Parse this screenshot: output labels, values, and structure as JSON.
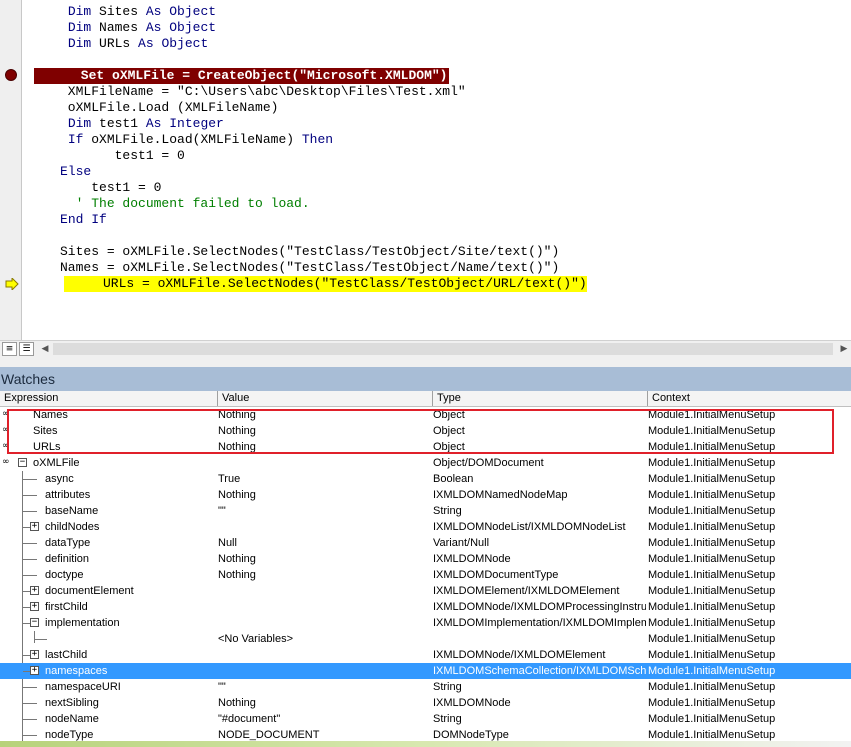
{
  "code": {
    "lines": [
      {
        "segments": [
          {
            "t": "      "
          },
          {
            "t": "Dim",
            "c": "kw"
          },
          {
            "t": " Sites "
          },
          {
            "t": "As",
            "c": "kw"
          },
          {
            "t": " "
          },
          {
            "t": "Object",
            "c": "kw"
          }
        ]
      },
      {
        "segments": [
          {
            "t": "      "
          },
          {
            "t": "Dim",
            "c": "kw"
          },
          {
            "t": " Names "
          },
          {
            "t": "As",
            "c": "kw"
          },
          {
            "t": " "
          },
          {
            "t": "Object",
            "c": "kw"
          }
        ]
      },
      {
        "segments": [
          {
            "t": "      "
          },
          {
            "t": "Dim",
            "c": "kw"
          },
          {
            "t": " URLs "
          },
          {
            "t": "As",
            "c": "kw"
          },
          {
            "t": " "
          },
          {
            "t": "Object",
            "c": "kw"
          }
        ]
      },
      {
        "segments": [
          {
            "t": ""
          }
        ]
      },
      {
        "segments": [
          {
            "t": "      Set oXMLFile = CreateObject(\"Microsoft.XMLDOM\")"
          }
        ],
        "state": "breakpoint"
      },
      {
        "segments": [
          {
            "t": "      XMLFileName = \"C:\\Users\\abc\\Desktop\\Files\\Test.xml\""
          }
        ]
      },
      {
        "segments": [
          {
            "t": "      oXMLFile.Load (XMLFileName)"
          }
        ]
      },
      {
        "segments": [
          {
            "t": "      "
          },
          {
            "t": "Dim",
            "c": "kw"
          },
          {
            "t": " test1 "
          },
          {
            "t": "As",
            "c": "kw"
          },
          {
            "t": " "
          },
          {
            "t": "Integer",
            "c": "kw"
          }
        ]
      },
      {
        "segments": [
          {
            "t": "      "
          },
          {
            "t": "If",
            "c": "kw"
          },
          {
            "t": " oXMLFile.Load(XMLFileName) "
          },
          {
            "t": "Then",
            "c": "kw"
          }
        ]
      },
      {
        "segments": [
          {
            "t": "            test1 = 0"
          }
        ]
      },
      {
        "segments": [
          {
            "t": "     "
          },
          {
            "t": "Else",
            "c": "kw"
          }
        ]
      },
      {
        "segments": [
          {
            "t": "         test1 = 0"
          }
        ]
      },
      {
        "segments": [
          {
            "t": "       "
          },
          {
            "t": "' The document failed to load.",
            "c": "cmt"
          }
        ]
      },
      {
        "segments": [
          {
            "t": "     "
          },
          {
            "t": "End If",
            "c": "kw"
          }
        ]
      },
      {
        "segments": [
          {
            "t": ""
          }
        ]
      },
      {
        "segments": [
          {
            "t": "     Sites = oXMLFile.SelectNodes(\"TestClass/TestObject/Site/text()\")"
          }
        ]
      },
      {
        "segments": [
          {
            "t": "     Names = oXMLFile.SelectNodes(\"TestClass/TestObject/Name/text()\")"
          }
        ]
      },
      {
        "segments": [
          {
            "t": "     URLs = oXMLFile.SelectNodes(\"TestClass/TestObject/URL/text()\")"
          }
        ],
        "state": "current"
      }
    ]
  },
  "view_buttons": {
    "procedure_icon": "procedure-view-icon",
    "module_icon": "full-module-view-icon"
  },
  "watches": {
    "title": "Watches",
    "columns": [
      "Expression",
      "Value",
      "Type",
      "Context"
    ],
    "rows": [
      {
        "level": 0,
        "icon": "watch",
        "name": "Names",
        "value": "Nothing",
        "type": "Object",
        "context": "Module1.InitialMenuSetup"
      },
      {
        "level": 0,
        "icon": "watch",
        "name": "Sites",
        "value": "Nothing",
        "type": "Object",
        "context": "Module1.InitialMenuSetup"
      },
      {
        "level": 0,
        "icon": "watch",
        "name": "URLs",
        "value": "Nothing",
        "type": "Object",
        "context": "Module1.InitialMenuSetup"
      },
      {
        "level": 0,
        "icon": "watch",
        "expand": "minus",
        "name": "oXMLFile",
        "value": "",
        "type": "Object/DOMDocument",
        "context": "Module1.InitialMenuSetup"
      },
      {
        "level": 1,
        "name": "async",
        "value": "True",
        "type": "Boolean",
        "context": "Module1.InitialMenuSetup"
      },
      {
        "level": 1,
        "name": "attributes",
        "value": "Nothing",
        "type": "IXMLDOMNamedNodeMap",
        "context": "Module1.InitialMenuSetup"
      },
      {
        "level": 1,
        "name": "baseName",
        "value": "\"\"",
        "type": "String",
        "context": "Module1.InitialMenuSetup"
      },
      {
        "level": 1,
        "expand": "plus",
        "name": "childNodes",
        "value": "",
        "type": "IXMLDOMNodeList/IXMLDOMNodeList",
        "context": "Module1.InitialMenuSetup"
      },
      {
        "level": 1,
        "name": "dataType",
        "value": "Null",
        "type": "Variant/Null",
        "context": "Module1.InitialMenuSetup"
      },
      {
        "level": 1,
        "name": "definition",
        "value": "Nothing",
        "type": "IXMLDOMNode",
        "context": "Module1.InitialMenuSetup"
      },
      {
        "level": 1,
        "name": "doctype",
        "value": "Nothing",
        "type": "IXMLDOMDocumentType",
        "context": "Module1.InitialMenuSetup"
      },
      {
        "level": 1,
        "expand": "plus",
        "name": "documentElement",
        "value": "",
        "type": "IXMLDOMElement/IXMLDOMElement",
        "context": "Module1.InitialMenuSetup"
      },
      {
        "level": 1,
        "expand": "plus",
        "name": "firstChild",
        "value": "",
        "type": "IXMLDOMNode/IXMLDOMProcessingInstructi",
        "context": "Module1.InitialMenuSetup"
      },
      {
        "level": 1,
        "expand": "minus",
        "name": "implementation",
        "value": "",
        "type": "IXMLDOMImplementation/IXMLDOMImplement",
        "context": "Module1.InitialMenuSetup"
      },
      {
        "level": 2,
        "name": "",
        "value": "<No Variables>",
        "type": "",
        "context": "Module1.InitialMenuSetup"
      },
      {
        "level": 1,
        "expand": "plus",
        "name": "lastChild",
        "value": "",
        "type": "IXMLDOMNode/IXMLDOMElement",
        "context": "Module1.InitialMenuSetup"
      },
      {
        "level": 1,
        "expand": "plus",
        "name": "namespaces",
        "value": "",
        "type": "IXMLDOMSchemaCollection/IXMLDOMSchem",
        "context": "Module1.InitialMenuSetup",
        "selected": true
      },
      {
        "level": 1,
        "name": "namespaceURI",
        "value": "\"\"",
        "type": "String",
        "context": "Module1.InitialMenuSetup"
      },
      {
        "level": 1,
        "name": "nextSibling",
        "value": "Nothing",
        "type": "IXMLDOMNode",
        "context": "Module1.InitialMenuSetup"
      },
      {
        "level": 1,
        "name": "nodeName",
        "value": "\"#document\"",
        "type": "String",
        "context": "Module1.InitialMenuSetup"
      },
      {
        "level": 1,
        "name": "nodeType",
        "value": "NODE_DOCUMENT",
        "type": "DOMNodeType",
        "context": "Module1.InitialMenuSetup"
      }
    ]
  },
  "colors": {
    "breakpoint": "#7f0000",
    "current_line": "#ffff00",
    "selected_row": "#3399ff",
    "annotation_box": "#e0202a",
    "watches_title_bg": "#a8bdd6"
  }
}
